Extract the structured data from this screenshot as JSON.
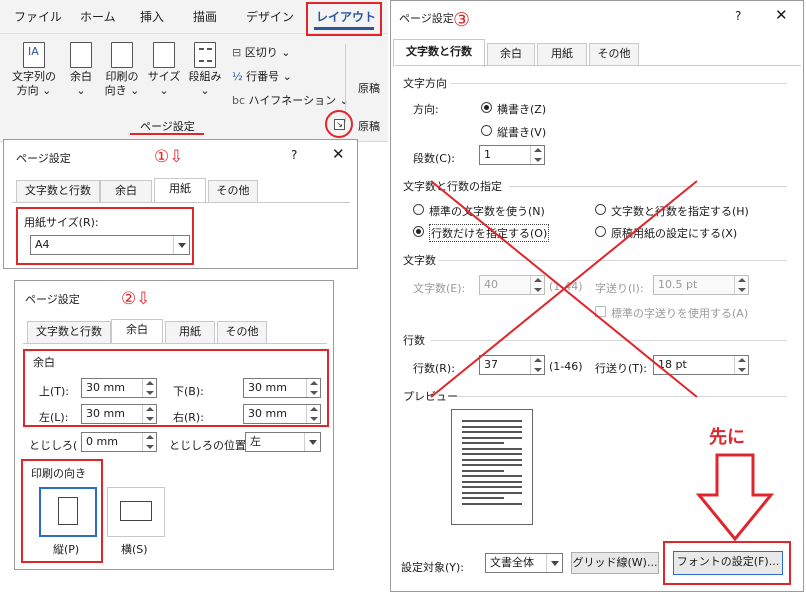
{
  "ribbon": {
    "tabs": [
      "ファイル",
      "ホーム",
      "挿入",
      "描画",
      "デザイン",
      "レイアウト"
    ],
    "buttons": {
      "text_direction": "文字列の\n方向 ⌄",
      "margins": "余白\n⌄",
      "orientation": "印刷の\n向き ⌄",
      "size": "サイズ\n⌄",
      "columns": "段組み\n⌄"
    },
    "small": {
      "breaks": "区切り ⌄",
      "line_numbers": "行番号 ⌄",
      "hyphenation": "ハイフネーション ⌄"
    },
    "group_label": "ページ設定",
    "overflow_1": "原稿",
    "overflow_2": "原稿"
  },
  "dialog1": {
    "title": "ページ設定",
    "help": "?",
    "close": "✕",
    "tabs": [
      "文字数と行数",
      "余白",
      "用紙",
      "その他"
    ],
    "paper_size_label": "用紙サイズ(R):",
    "paper_size_value": "A4",
    "annotation": "①⇩"
  },
  "dialog2": {
    "title": "ページ設定",
    "tabs": [
      "文字数と行数",
      "余白",
      "用紙",
      "その他"
    ],
    "annotation": "②⇩",
    "margins_group": "余白",
    "top_label": "上(T):",
    "top_value": "30 mm",
    "bottom_label": "下(B):",
    "bottom_value": "30 mm",
    "left_label": "左(L):",
    "left_value": "30 mm",
    "right_label": "右(R):",
    "right_value": "30 mm",
    "gutter_label": "とじしろ(",
    "gutter_value": "0 mm",
    "gutter_pos_label": "とじしろの位置",
    "gutter_pos_value": "左",
    "orientation_group": "印刷の向き",
    "portrait": "縦(P)",
    "landscape": "横(S)"
  },
  "dialog3": {
    "title": "ページ設定",
    "help": "?",
    "close": "✕",
    "annotation": "③",
    "tabs": [
      "文字数と行数",
      "余白",
      "用紙",
      "その他"
    ],
    "direction_group": "文字方向",
    "direction_label": "方向:",
    "horizontal": "横書き(Z)",
    "vertical": "縦書き(V)",
    "columns_label": "段数(C):",
    "columns_value": "1",
    "grid_group": "文字数と行数の指定",
    "opt_standard": "標準の文字数を使う(N)",
    "opt_chars_lines": "文字数と行数を指定する(H)",
    "opt_lines_only": "行数だけを指定する(O)",
    "opt_manuscript": "原稿用紙の設定にする(X)",
    "chars_group": "文字数",
    "chars_label": "文字数(E):",
    "chars_value": "40",
    "chars_range": "(1-44)",
    "pitch_label": "字送り(I):",
    "pitch_value": "10.5 pt",
    "standard_pitch": "標準の字送りを使用する(A)",
    "lines_group": "行数",
    "lines_label": "行数(R):",
    "lines_value": "37",
    "lines_range": "(1-46)",
    "line_pitch_label": "行送り(T):",
    "line_pitch_value": "18 pt",
    "preview_group": "プレビュー",
    "apply_label": "設定対象(Y):",
    "apply_value": "文書全体",
    "grid_button": "グリッド線(W)...",
    "font_button": "フォントの設定(F)...",
    "callout": "先に"
  },
  "colors": {
    "accent_red": "#e0262c",
    "word_blue": "#2b579a"
  }
}
